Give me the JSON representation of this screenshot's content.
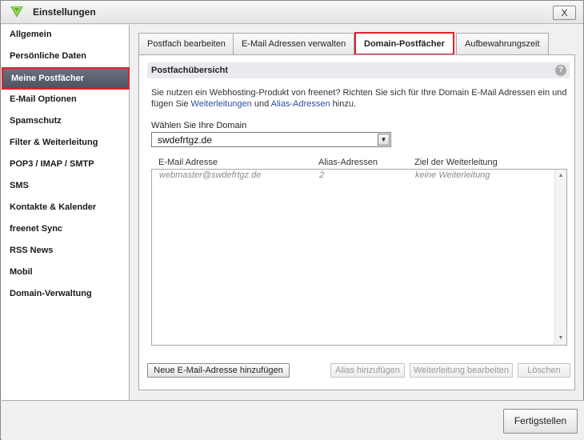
{
  "window": {
    "title": "Einstellungen",
    "close_label": "X"
  },
  "sidebar": {
    "items": [
      {
        "label": "Allgemein"
      },
      {
        "label": "Persönliche Daten"
      },
      {
        "label": "Meine Postfächer",
        "active": true
      },
      {
        "label": "E-Mail Optionen"
      },
      {
        "label": "Spamschutz"
      },
      {
        "label": "Filter & Weiterleitung"
      },
      {
        "label": "POP3 / IMAP / SMTP"
      },
      {
        "label": "SMS"
      },
      {
        "label": "Kontakte & Kalender"
      },
      {
        "label": "freenet Sync"
      },
      {
        "label": "RSS News"
      },
      {
        "label": "Mobil"
      },
      {
        "label": "Domain-Verwaltung"
      }
    ]
  },
  "tabs": [
    {
      "label": "Postfach bearbeiten"
    },
    {
      "label": "E-Mail Adressen verwalten"
    },
    {
      "label": "Domain-Postfächer",
      "active": true
    },
    {
      "label": "Aufbewahrungszeit"
    }
  ],
  "panel": {
    "section_title": "Postfachübersicht",
    "help_label": "?",
    "intro_part1": "Sie nutzen ein Webhosting-Produkt von freenet? Richten Sie sich für Ihre Domain E-Mail Adressen ein und fügen Sie ",
    "intro_link1": "Weiterleitungen",
    "intro_part2": " und ",
    "intro_link2": "Alias-Adressen",
    "intro_part3": " hinzu.",
    "domain_label": "Wählen Sie Ihre Domain",
    "domain_value": "swdefrtgz.de",
    "columns": {
      "email": "E-Mail Adresse",
      "alias": "Alias-Adressen",
      "target": "Ziel der Weiterleitung"
    },
    "rows": [
      {
        "email": "webmaster@swdefrtgz.de",
        "alias": "2",
        "target": "keine Weiterleitung"
      }
    ],
    "buttons": {
      "add": "Neue E-Mail-Adresse hinzufügen",
      "add_alias": "Alias hinzufügen",
      "edit_forward": "Weiterleitung bearbeiten",
      "delete": "Löschen"
    }
  },
  "footer": {
    "finish_label": "Fertigstellen"
  },
  "colors": {
    "highlight_border": "#e0202a",
    "link": "#2a4fa0",
    "active_sidebar": "#5a6270",
    "logo_green": "#7cc242"
  }
}
